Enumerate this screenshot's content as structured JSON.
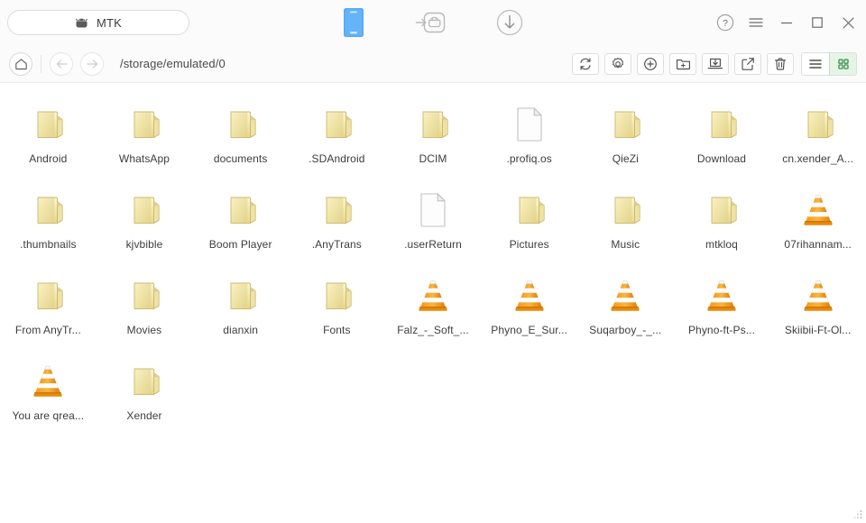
{
  "titlebar": {
    "device_tab": {
      "label": "MTK",
      "icon": "android-head-icon"
    },
    "center_icons": [
      {
        "name": "device-phone-icon",
        "label": "Device"
      },
      {
        "name": "install-apk-to-android-icon",
        "label": "Install to Android"
      },
      {
        "name": "download-icon",
        "label": "Download"
      }
    ],
    "window_controls": [
      {
        "name": "help-icon",
        "glyph": "?"
      },
      {
        "name": "menu-icon",
        "glyph": "≡"
      },
      {
        "name": "minimize-icon",
        "glyph": "─"
      },
      {
        "name": "maximize-icon",
        "glyph": "□"
      },
      {
        "name": "close-icon",
        "glyph": "✕"
      }
    ]
  },
  "navbar": {
    "home_label": "Home",
    "back_label": "Back",
    "forward_label": "Forward",
    "path": "/storage/emulated/0",
    "tools": [
      {
        "name": "refresh-button",
        "label": "Refresh"
      },
      {
        "name": "settings-button",
        "label": "Settings"
      },
      {
        "name": "add-button",
        "label": "Add"
      },
      {
        "name": "new-folder-button",
        "label": "New Folder"
      },
      {
        "name": "export-to-computer-button",
        "label": "Export to Computer"
      },
      {
        "name": "rename-button",
        "label": "Rename"
      },
      {
        "name": "delete-button",
        "label": "Delete"
      }
    ],
    "view_list_label": "List view",
    "view_grid_label": "Grid view",
    "active_view": "grid"
  },
  "colors": {
    "accent_green": "#e4f5e6",
    "accent_green_border": "#bfe3c5",
    "device_blue": "#4a9cf0",
    "folder_yellow": "#efe09a",
    "text": "#3d3d3d"
  },
  "files": [
    {
      "name": "Android",
      "type": "folder"
    },
    {
      "name": "WhatsApp",
      "type": "folder"
    },
    {
      "name": "documents",
      "type": "folder"
    },
    {
      "name": ".SDAndroid",
      "type": "folder"
    },
    {
      "name": "DCIM",
      "type": "folder"
    },
    {
      "name": ".profiq.os",
      "type": "file"
    },
    {
      "name": "QieZi",
      "type": "folder"
    },
    {
      "name": "Download",
      "type": "folder"
    },
    {
      "name": "cn.xender_A...",
      "type": "folder"
    },
    {
      "name": ".thumbnails",
      "type": "folder"
    },
    {
      "name": "kjvbible",
      "type": "folder"
    },
    {
      "name": "Boom Player",
      "type": "folder"
    },
    {
      "name": ".AnyTrans",
      "type": "folder"
    },
    {
      "name": ".userReturn",
      "type": "file"
    },
    {
      "name": "Pictures",
      "type": "folder"
    },
    {
      "name": "Music",
      "type": "folder"
    },
    {
      "name": "mtkloq",
      "type": "folder"
    },
    {
      "name": "07rihannam...",
      "type": "video"
    },
    {
      "name": "From AnyTr...",
      "type": "folder"
    },
    {
      "name": "Movies",
      "type": "folder"
    },
    {
      "name": "dianxin",
      "type": "folder"
    },
    {
      "name": "Fonts",
      "type": "folder"
    },
    {
      "name": "Falz_-_Soft_...",
      "type": "video"
    },
    {
      "name": "Phyno_E_Sur...",
      "type": "video"
    },
    {
      "name": "Suqarboy_-_...",
      "type": "video"
    },
    {
      "name": "Phyno-ft-Ps...",
      "type": "video"
    },
    {
      "name": "Skiibii-Ft-Ol...",
      "type": "video"
    },
    {
      "name": "You are qrea...",
      "type": "video"
    },
    {
      "name": "Xender",
      "type": "folder"
    }
  ]
}
